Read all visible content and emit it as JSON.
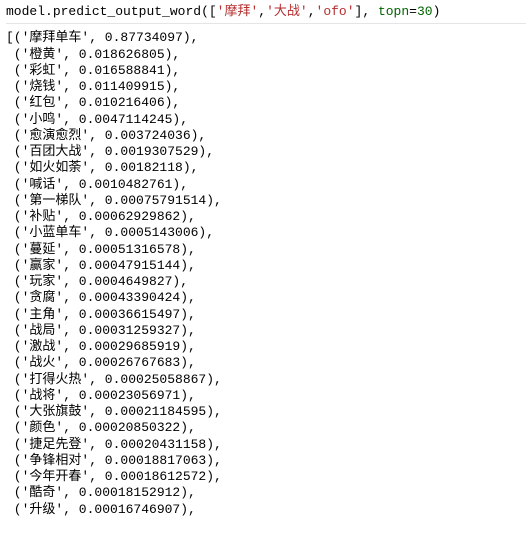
{
  "input": {
    "obj": "model",
    "method": "predict_output_word",
    "args_open": "([",
    "strings": [
      "'摩拜'",
      "'大战'",
      "'ofo'"
    ],
    "sep": ",",
    "args_close": "],",
    "kw_name": "topn",
    "kw_eq": "=",
    "kw_val": "30",
    "end": ")"
  },
  "output": {
    "open": "[",
    "rows": [
      {
        "word": "摩拜单车",
        "val": "0.87734097",
        "indent": ""
      },
      {
        "word": "橙黄",
        "val": "0.018626805",
        "indent": " "
      },
      {
        "word": "彩虹",
        "val": "0.016588841",
        "indent": " "
      },
      {
        "word": "烧钱",
        "val": "0.011409915",
        "indent": " "
      },
      {
        "word": "红包",
        "val": "0.010216406",
        "indent": " "
      },
      {
        "word": "小鸣",
        "val": "0.0047114245",
        "indent": " "
      },
      {
        "word": "愈演愈烈",
        "val": "0.003724036",
        "indent": " "
      },
      {
        "word": "百团大战",
        "val": "0.0019307529",
        "indent": " "
      },
      {
        "word": "如火如荼",
        "val": "0.00182118",
        "indent": " "
      },
      {
        "word": "喊话",
        "val": "0.0010482761",
        "indent": " "
      },
      {
        "word": "第一梯队",
        "val": "0.00075791514",
        "indent": " "
      },
      {
        "word": "补贴",
        "val": "0.00062929862",
        "indent": " "
      },
      {
        "word": "小蓝单车",
        "val": "0.0005143006",
        "indent": " "
      },
      {
        "word": "蔓延",
        "val": "0.00051316578",
        "indent": " "
      },
      {
        "word": "赢家",
        "val": "0.00047915144",
        "indent": " "
      },
      {
        "word": "玩家",
        "val": "0.0004649827",
        "indent": " "
      },
      {
        "word": "贪腐",
        "val": "0.00043390424",
        "indent": " "
      },
      {
        "word": "主角",
        "val": "0.00036615497",
        "indent": " "
      },
      {
        "word": "战局",
        "val": "0.00031259327",
        "indent": " "
      },
      {
        "word": "激战",
        "val": "0.00029685919",
        "indent": " "
      },
      {
        "word": "战火",
        "val": "0.00026767683",
        "indent": " "
      },
      {
        "word": "打得火热",
        "val": "0.00025058867",
        "indent": " "
      },
      {
        "word": "战将",
        "val": "0.00023056971",
        "indent": " "
      },
      {
        "word": "大张旗鼓",
        "val": "0.00021184595",
        "indent": " "
      },
      {
        "word": "颜色",
        "val": "0.00020850322",
        "indent": " "
      },
      {
        "word": "捷足先登",
        "val": "0.00020431158",
        "indent": " "
      },
      {
        "word": "争锋相对",
        "val": "0.00018817063",
        "indent": " "
      },
      {
        "word": "今年开春",
        "val": "0.00018612572",
        "indent": " "
      },
      {
        "word": "酷奇",
        "val": "0.00018152912",
        "indent": " "
      },
      {
        "word": "升级",
        "val": "0.00016746907",
        "indent": " "
      }
    ]
  }
}
